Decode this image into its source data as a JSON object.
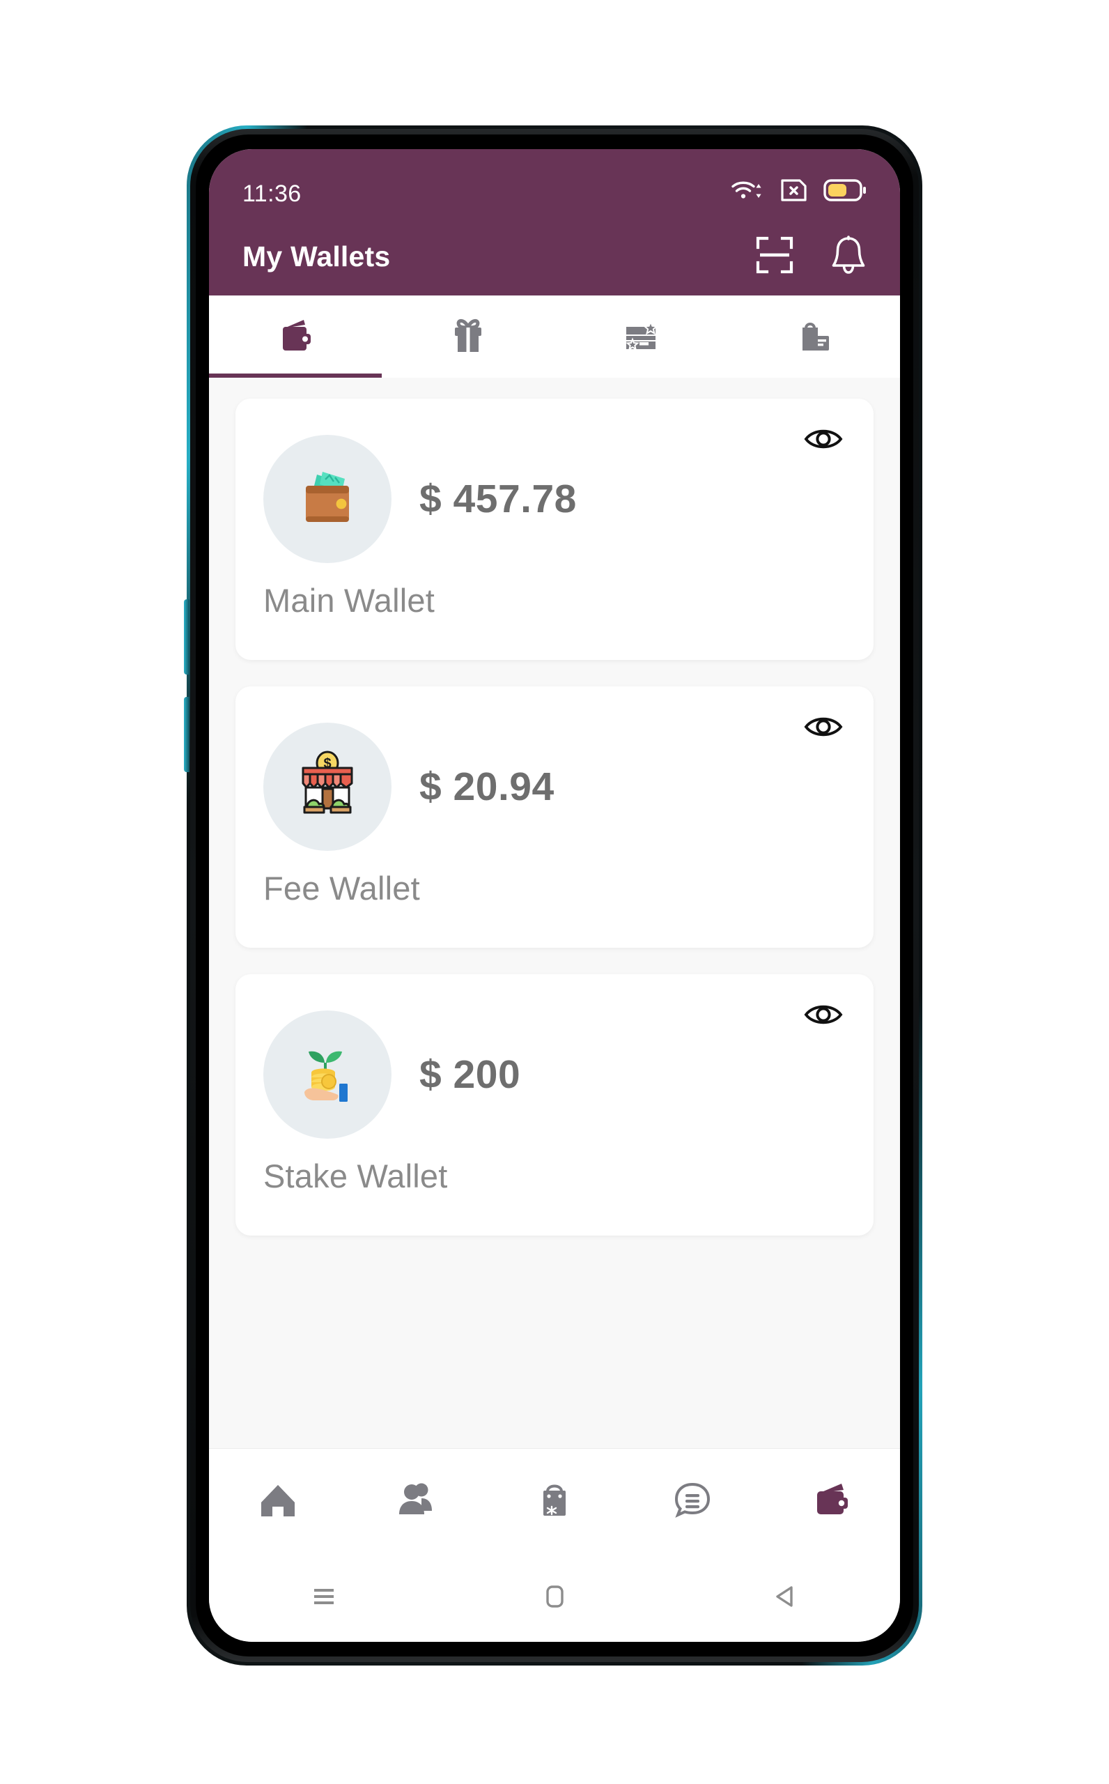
{
  "status_bar": {
    "time": "11:36",
    "icons": [
      "wifi-data-icon",
      "sim-no-service-icon",
      "battery-icon"
    ],
    "battery_level_pct": 55
  },
  "app_bar": {
    "title": "My Wallets",
    "actions": [
      {
        "name": "scan-qr-button"
      },
      {
        "name": "notifications-bell-button"
      }
    ]
  },
  "tabs": [
    {
      "label": "Wallets",
      "icon": "wallet-icon",
      "active": true
    },
    {
      "label": "Gifts",
      "icon": "gift-icon",
      "active": false
    },
    {
      "label": "Coupons",
      "icon": "loyalty-card-icon",
      "active": false
    },
    {
      "label": "Shop",
      "icon": "shopping-bag-card-icon",
      "active": false
    }
  ],
  "wallets": [
    {
      "name": "Main Wallet",
      "balance": "$ 457.78",
      "icon": "wallet-cash-icon",
      "toggle": "eye-icon"
    },
    {
      "name": "Fee Wallet",
      "balance": "$ 20.94",
      "icon": "storefront-coin-icon",
      "toggle": "eye-icon"
    },
    {
      "name": "Stake Wallet",
      "balance": "$ 200",
      "icon": "hand-coins-plant-icon",
      "toggle": "eye-icon"
    }
  ],
  "bottom_nav": [
    {
      "label": "Home",
      "icon": "home-icon",
      "active": false
    },
    {
      "label": "Contacts",
      "icon": "people-icon",
      "active": false
    },
    {
      "label": "Shop",
      "icon": "shopping-bag-icon",
      "active": false
    },
    {
      "label": "Chat",
      "icon": "chat-bubble-icon",
      "active": false
    },
    {
      "label": "Wallet",
      "icon": "wallet-icon",
      "active": true
    }
  ],
  "system_nav": [
    {
      "label": "Recents",
      "icon": "recents-icon"
    },
    {
      "label": "Home",
      "icon": "home-square-icon"
    },
    {
      "label": "Back",
      "icon": "back-triangle-icon"
    }
  ],
  "colors": {
    "brand_purple": "#683456",
    "page_background": "#f8f8f8",
    "card_background": "#ffffff",
    "balance_text": "#6e6e6e",
    "wallet_name_text": "#8a8a8a",
    "inactive_icon": "#7c7c82",
    "battery_fill": "#fad25f",
    "device_edge": "#27aec4"
  }
}
